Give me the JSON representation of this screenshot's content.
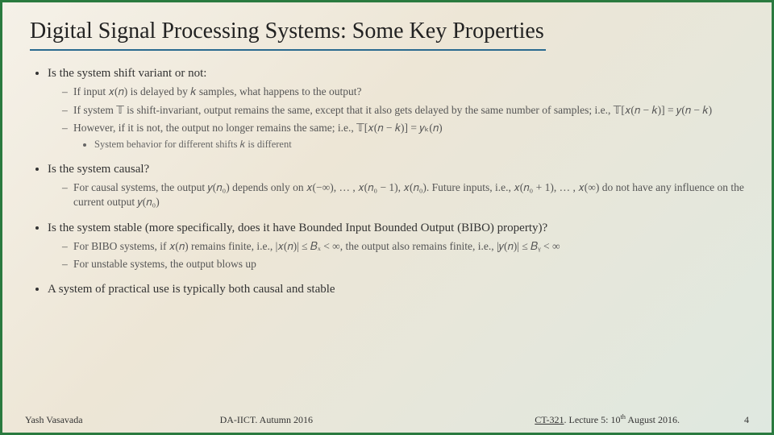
{
  "title": "Digital Signal Processing Systems: Some Key Properties",
  "bullets": {
    "b1": {
      "text": "Is the system shift variant or not:",
      "sub": {
        "s1": "If input 𝑥(𝑛) is delayed by 𝑘 samples, what happens to the output?",
        "s2": "If system 𝕋 is shift-invariant, output remains the same, except that it also gets delayed by the same number of samples; i.e., 𝕋[𝑥(𝑛 − 𝑘)] = 𝑦(𝑛 − 𝑘)",
        "s3": "However, if it is not, the output no longer remains the same; i.e., 𝕋[𝑥(𝑛 − 𝑘)] = 𝑦ₖ(𝑛)",
        "s3a": "System behavior for different shifts 𝑘 is different"
      }
    },
    "b2": {
      "text": "Is the system causal?",
      "sub": {
        "s1": "For causal systems, the output 𝑦(𝑛₀) depends only on 𝑥(−∞), … , 𝑥(𝑛₀ − 1), 𝑥(𝑛₀). Future inputs, i.e., 𝑥(𝑛₀ + 1), … , 𝑥(∞) do not have any influence on the current output 𝑦(𝑛₀)"
      }
    },
    "b3": {
      "text": "Is the system stable (more specifically, does it have Bounded Input Bounded Output (BIBO) property)?",
      "sub": {
        "s1": "For BIBO systems, if 𝑥(𝑛) remains finite, i.e., |𝑥(𝑛)| ≤ 𝐵ₓ < ∞, the output also remains finite, i.e., |𝑦(𝑛)| ≤ 𝐵ᵧ < ∞",
        "s2": "For unstable systems, the output blows up"
      }
    },
    "b4": {
      "text": "A system of practical use is typically both causal and stable"
    }
  },
  "footer": {
    "author": "Yash Vasavada",
    "institution": "DA-IICT. Autumn 2016",
    "course": "CT-321",
    "lecture_prefix": ". Lecture 5: 10",
    "lecture_suffix": " August 2016.",
    "ord": "th",
    "page": "4"
  }
}
